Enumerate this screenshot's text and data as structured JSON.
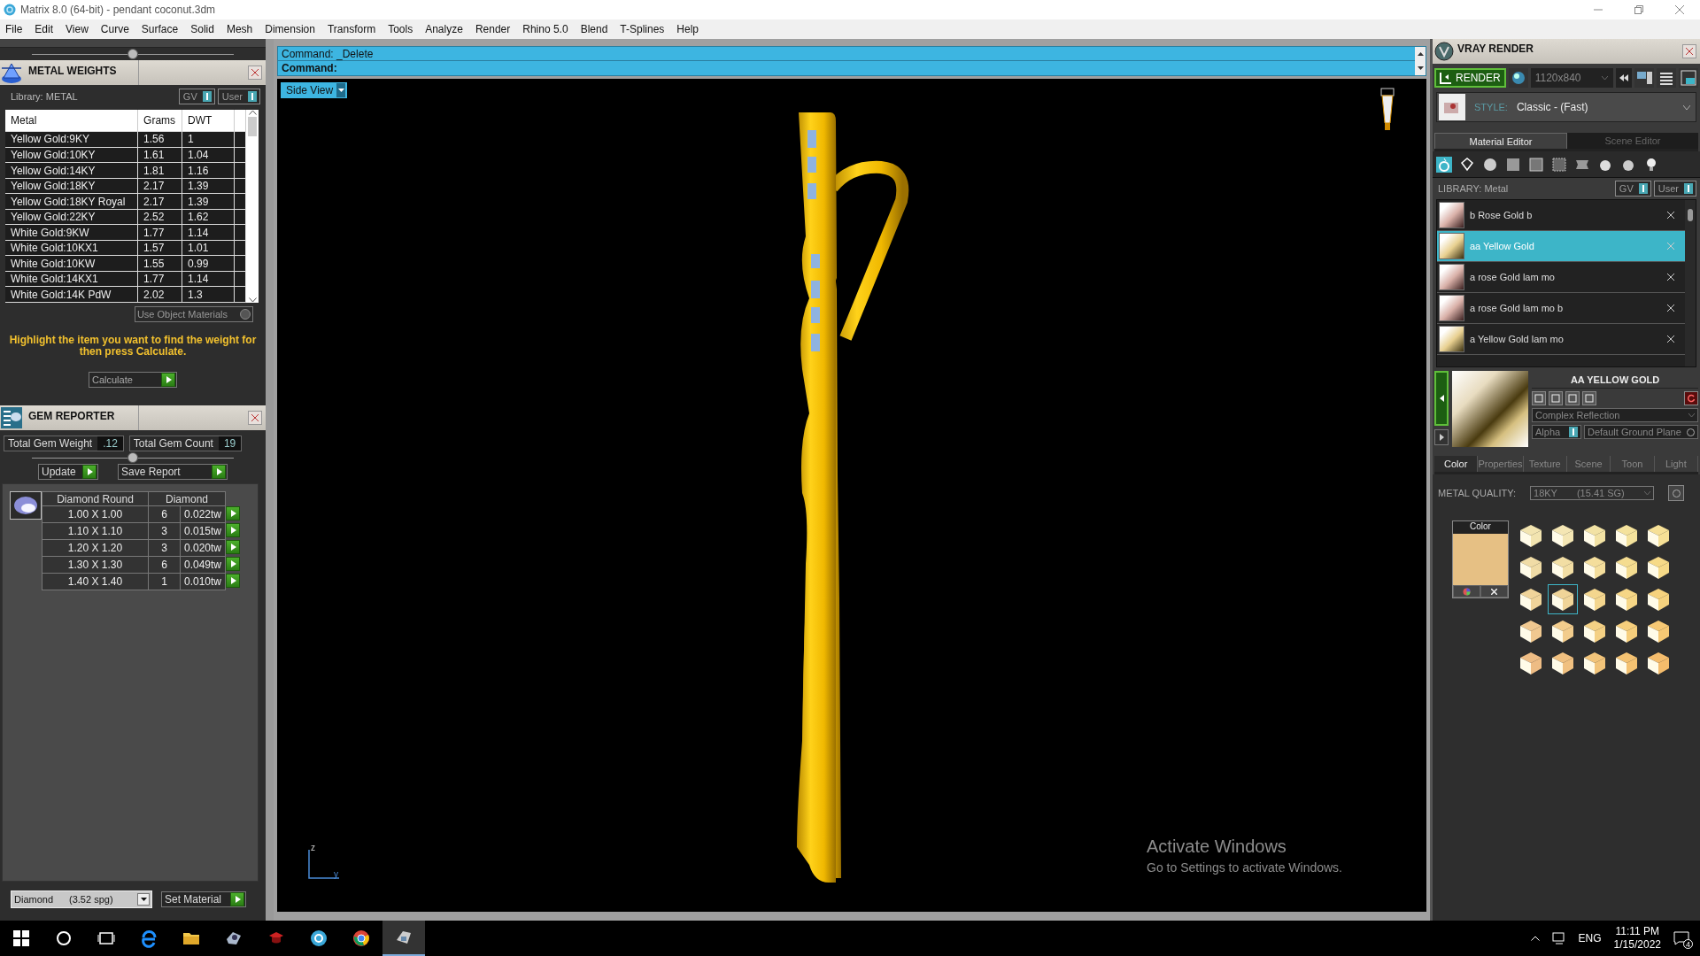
{
  "window": {
    "title": "Matrix 8.0 (64-bit) - pendant coconut.3dm"
  },
  "menu": [
    "File",
    "Edit",
    "View",
    "Curve",
    "Surface",
    "Solid",
    "Mesh",
    "Dimension",
    "Transform",
    "Tools",
    "Analyze",
    "Render",
    "Rhino 5.0",
    "Blend",
    "T-Splines",
    "Help"
  ],
  "metal_weights": {
    "title": "METAL WEIGHTS",
    "library": "Library: METAL",
    "toggles": [
      "GV",
      "User"
    ],
    "columns": [
      "Metal",
      "Grams",
      "DWT"
    ],
    "rows": [
      [
        "Yellow Gold:9KY",
        "1.56",
        "1"
      ],
      [
        "Yellow Gold:10KY",
        "1.61",
        "1.04"
      ],
      [
        "Yellow Gold:14KY",
        "1.81",
        "1.16"
      ],
      [
        "Yellow Gold:18KY",
        "2.17",
        "1.39"
      ],
      [
        "Yellow Gold:18KY Royal",
        "2.17",
        "1.39"
      ],
      [
        "Yellow Gold:22KY",
        "2.52",
        "1.62"
      ],
      [
        "White Gold:9KW",
        "1.77",
        "1.14"
      ],
      [
        "White Gold:10KX1",
        "1.57",
        "1.01"
      ],
      [
        "White Gold:10KW",
        "1.55",
        "0.99"
      ],
      [
        "White Gold:14KX1",
        "1.77",
        "1.14"
      ],
      [
        "White Gold:14K PdW",
        "2.02",
        "1.3"
      ]
    ],
    "use_object_materials": "Use Object Materials",
    "hint": "Highlight the item you want to find the weight for then press Calculate.",
    "calculate": "Calculate"
  },
  "gem_reporter": {
    "title": "GEM REPORTER",
    "total_weight_label": "Total Gem Weight",
    "total_weight": ".12",
    "total_count_label": "Total Gem Count",
    "total_count": "19",
    "update": "Update",
    "save_report": "Save Report",
    "shape_header": "Diamond Round",
    "stone_header": "Diamond",
    "stones": [
      {
        "size": "1.00 X 1.00",
        "count": "6",
        "weight": "0.022tw"
      },
      {
        "size": "1.10 X 1.10",
        "count": "3",
        "weight": "0.015tw"
      },
      {
        "size": "1.20 X 1.20",
        "count": "3",
        "weight": "0.020tw"
      },
      {
        "size": "1.30 X 1.30",
        "count": "6",
        "weight": "0.049tw"
      },
      {
        "size": "1.40 X 1.40",
        "count": "1",
        "weight": "0.010tw"
      }
    ],
    "material_name": "Diamond",
    "material_density": "(3.52 spg)",
    "set_material": "Set Material"
  },
  "command": {
    "lines": [
      "Command: _Delete",
      "Command:"
    ]
  },
  "viewport": {
    "view": "Side View",
    "axes": [
      "z",
      "y"
    ]
  },
  "vray": {
    "title": "VRAY RENDER",
    "render": "RENDER",
    "resolution": "1120x840",
    "style_label": "STYLE:",
    "style": "Classic - (Fast)",
    "tabs": [
      {
        "label": "Material Editor",
        "selected": true
      },
      {
        "label": "Scene Editor",
        "selected": false
      }
    ],
    "library": "LIBRARY: Metal",
    "toggles": [
      "GV",
      "User"
    ],
    "materials": [
      {
        "name": "b Rose Gold b",
        "kind": "rose",
        "selected": false
      },
      {
        "name": "aa Yellow Gold",
        "kind": "yellow",
        "selected": true
      },
      {
        "name": "a rose Gold lam mo",
        "kind": "rose",
        "selected": false
      },
      {
        "name": "a rose Gold lam mo b",
        "kind": "rose",
        "selected": false
      },
      {
        "name": "a Yellow Gold lam mo",
        "kind": "yellow",
        "selected": false
      }
    ],
    "material_title": "AA YELLOW GOLD",
    "reflection": "Complex Reflection",
    "alpha": "Alpha",
    "ground": "Default Ground Plane",
    "subtabs": [
      {
        "label": "Color",
        "selected": true
      },
      {
        "label": "Properties",
        "selected": false
      },
      {
        "label": "Texture",
        "selected": false
      },
      {
        "label": "Scene",
        "selected": false
      },
      {
        "label": "Toon",
        "selected": false
      },
      {
        "label": "Light",
        "selected": false
      }
    ],
    "metal_quality_label": "METAL QUALITY:",
    "metal_quality": "18KY",
    "metal_sg": "(15.41 SG)",
    "color_label": "Color",
    "color": "#e6c084",
    "swatches": [
      {
        "color": "#f2e4b0",
        "selected": false
      },
      {
        "color": "#f4e6b4",
        "selected": false
      },
      {
        "color": "#f2e2a4",
        "selected": false
      },
      {
        "color": "#f4e29c",
        "selected": false
      },
      {
        "color": "#f6e096",
        "selected": false
      },
      {
        "color": "#f0dca6",
        "selected": false
      },
      {
        "color": "#f2dea4",
        "selected": false
      },
      {
        "color": "#f4de9c",
        "selected": false
      },
      {
        "color": "#f4dc90",
        "selected": false
      },
      {
        "color": "#f6da88",
        "selected": false
      },
      {
        "color": "#f0d49a",
        "selected": false
      },
      {
        "color": "#f0d498",
        "selected": true
      },
      {
        "color": "#f4d68e",
        "selected": false
      },
      {
        "color": "#f6d686",
        "selected": false
      },
      {
        "color": "#f6d27e",
        "selected": false
      },
      {
        "color": "#f0c890",
        "selected": false
      },
      {
        "color": "#f2cc8c",
        "selected": false
      },
      {
        "color": "#f4d084",
        "selected": false
      },
      {
        "color": "#f6ce7c",
        "selected": false
      },
      {
        "color": "#f6c874",
        "selected": false
      },
      {
        "color": "#eebc84",
        "selected": false
      },
      {
        "color": "#f0c080",
        "selected": false
      },
      {
        "color": "#f2c47a",
        "selected": false
      },
      {
        "color": "#f4c272",
        "selected": false
      },
      {
        "color": "#f4bc6c",
        "selected": false
      }
    ]
  },
  "activation": {
    "title": "Activate Windows",
    "text": "Go to Settings to activate Windows."
  },
  "taskbar": {
    "language": "ENG",
    "time": "11:11 PM",
    "date": "1/15/2022",
    "notifications": "4"
  }
}
